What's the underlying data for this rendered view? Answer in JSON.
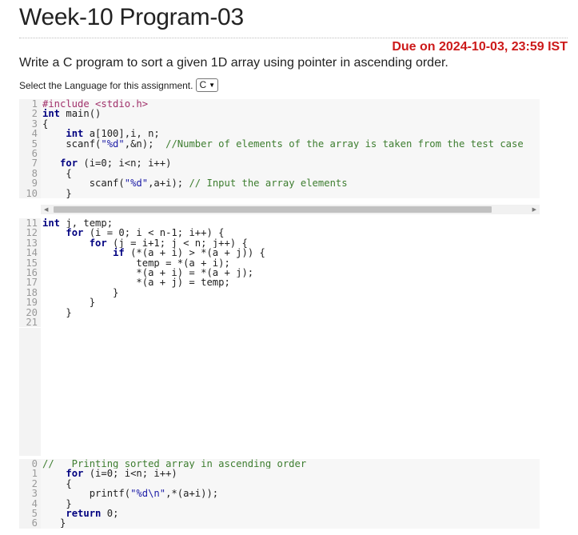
{
  "page_title": "Week-10 Program-03",
  "due": "Due on 2024-10-03, 23:59 IST",
  "description": "Write a C program to sort a given 1D array using pointer in ascending order.",
  "language_label": "Select the Language for this assignment.",
  "language_selected": "C",
  "prefix_lines": [
    {
      "n": "1",
      "text": "#include <stdio.h>"
    },
    {
      "n": "2",
      "text": "int main()"
    },
    {
      "n": "3",
      "text": "{"
    },
    {
      "n": "4",
      "text": "    int a[100],i, n;"
    },
    {
      "n": "5",
      "text": "    scanf(\"%d\",&n);  //Number of elements of the array is taken from the test case"
    },
    {
      "n": "6",
      "text": ""
    },
    {
      "n": "7",
      "text": "   for (i=0; i<n; i++)"
    },
    {
      "n": "8",
      "text": "    {"
    },
    {
      "n": "9",
      "text": "        scanf(\"%d\",a+i); // Input the array elements"
    },
    {
      "n": "10",
      "text": "    }"
    }
  ],
  "editor_lines": [
    {
      "n": "11",
      "text": "int j, temp;"
    },
    {
      "n": "12",
      "text": "    for (i = 0; i < n-1; i++) {"
    },
    {
      "n": "13",
      "text": "        for (j = i+1; j < n; j++) {"
    },
    {
      "n": "14",
      "text": "            if (*(a + i) > *(a + j)) {"
    },
    {
      "n": "15",
      "text": "                temp = *(a + i);"
    },
    {
      "n": "16",
      "text": "                *(a + i) = *(a + j);"
    },
    {
      "n": "17",
      "text": "                *(a + j) = temp;"
    },
    {
      "n": "18",
      "text": "            }"
    },
    {
      "n": "19",
      "text": "        }"
    },
    {
      "n": "20",
      "text": "    }"
    },
    {
      "n": "21",
      "text": ""
    }
  ],
  "suffix_lines": [
    {
      "n": "0",
      "text": "//   Printing sorted array in ascending order"
    },
    {
      "n": "1",
      "text": "    for (i=0; i<n; i++)"
    },
    {
      "n": "2",
      "text": "    {"
    },
    {
      "n": "3",
      "text": "        printf(\"%d\\n\",*(a+i));"
    },
    {
      "n": "4",
      "text": "    }"
    },
    {
      "n": "5",
      "text": "    return 0;"
    },
    {
      "n": "6",
      "text": "   }"
    }
  ]
}
